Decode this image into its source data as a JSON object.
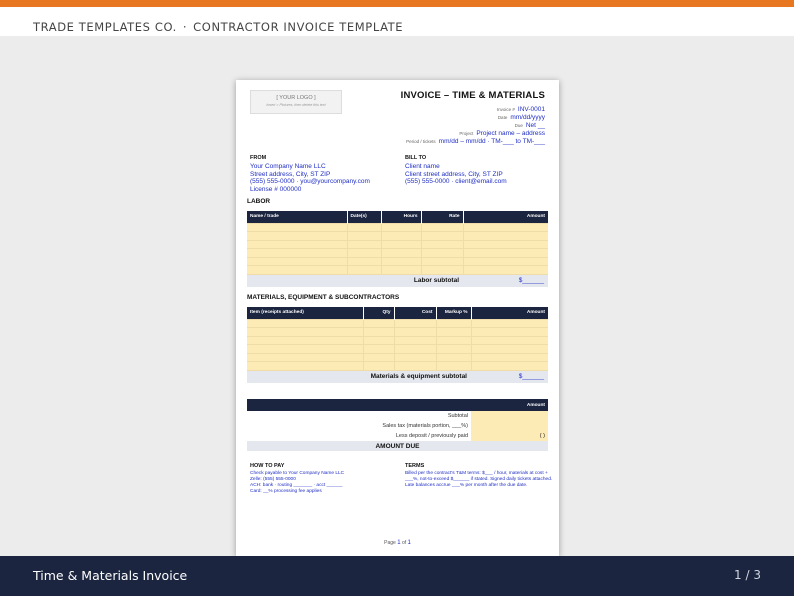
{
  "header": {
    "brand": "TRADE TEMPLATES CO.",
    "separator": "·",
    "subtitle": "CONTRACTOR INVOICE TEMPLATE",
    "accent_color": "#e87722"
  },
  "invoice": {
    "logo_placeholder": "[ YOUR LOGO ]",
    "logo_hint": "Insert > Pictures, then delete this text",
    "title": "INVOICE – TIME & MATERIALS",
    "meta": [
      {
        "label": "Invoice #",
        "value": "INV-0001"
      },
      {
        "label": "Date",
        "value": "mm/dd/yyyy"
      },
      {
        "label": "Due",
        "value": "Net __"
      },
      {
        "label": "Project",
        "value": "Project name – address"
      },
      {
        "label": "Period / tickets",
        "value": "mm/dd – mm/dd · TM-___ to TM-___"
      }
    ],
    "from": {
      "heading": "FROM",
      "lines": [
        "Your Company Name LLC",
        "Street address, City, ST ZIP",
        "(555) 555-0000 · you@yourcompany.com",
        "License # 000000"
      ]
    },
    "bill_to": {
      "heading": "BILL TO",
      "lines": [
        "Client name",
        "Client street address, City, ST ZIP",
        "(555) 555-0000 · client@email.com"
      ]
    },
    "labor": {
      "title": "LABOR",
      "columns": [
        "Name / trade",
        "Date(s)",
        "Hours",
        "Rate",
        "Amount"
      ],
      "row_count": 6,
      "subtotal_label": "Labor subtotal",
      "subtotal_value": "$______"
    },
    "materials": {
      "title": "MATERIALS, EQUIPMENT & SUBCONTRACTORS",
      "columns": [
        "Item (receipts attached)",
        "Qty",
        "Cost",
        "Markup %",
        "Amount"
      ],
      "row_count": 6,
      "subtotal_label": "Materials & equipment subtotal",
      "subtotal_value": "$______"
    },
    "totals": {
      "header": "Amount",
      "rows": [
        {
          "label": "Subtotal",
          "value": ""
        },
        {
          "label": "Sales tax (materials portion, ___%)",
          "value": ""
        },
        {
          "label": "Less deposit / previously paid",
          "value": "(   )"
        }
      ],
      "amount_due_label": "AMOUNT DUE"
    },
    "how_to_pay": {
      "heading": "HOW TO PAY",
      "lines": [
        "Check payable to Your Company Name LLC",
        "Zelle: (555) 555-0000",
        "ACH: bank · routing _______ · acct ______",
        "Card: __% processing fee applies"
      ]
    },
    "terms": {
      "heading": "TERMS",
      "text": "Billed per the contract's T&M terms: $___ / hour, materials at cost + ___%, not-to-exceed $______ if stated. Signed daily tickets attached. Late balances accrue ___% per month after the due date."
    },
    "page_label": "Page",
    "page_current": "1",
    "page_of": "of",
    "page_total": "1"
  },
  "footer": {
    "title": "Time & Materials Invoice",
    "pager": "1 / 3"
  },
  "colors": {
    "navy": "#1b2540",
    "fill_yellow": "#fdebb5",
    "link_blue": "#1f2ec4"
  }
}
